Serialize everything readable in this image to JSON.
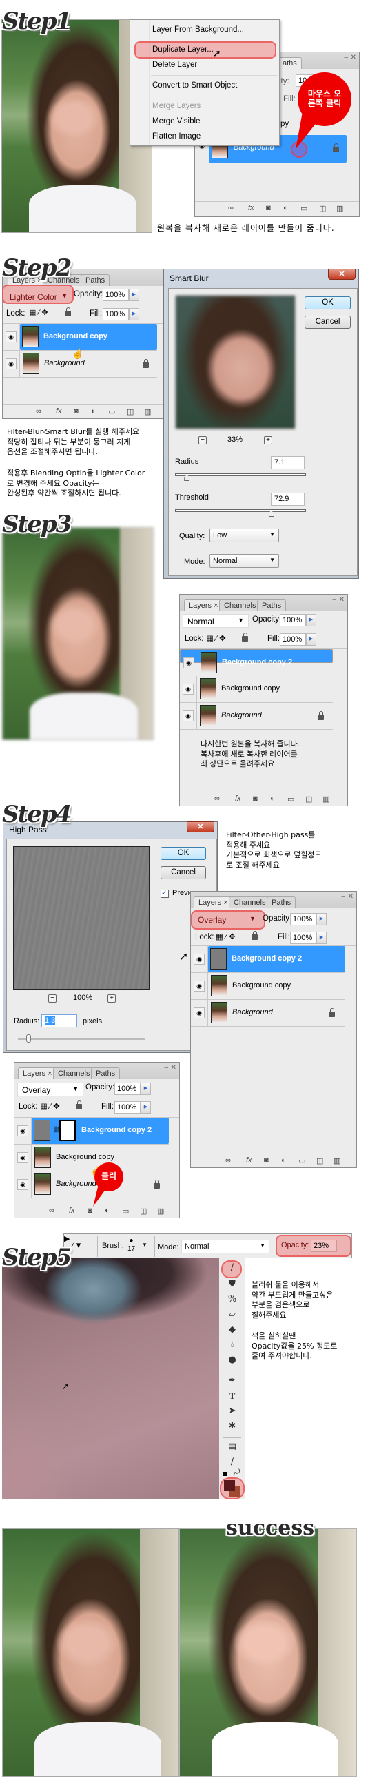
{
  "step1": {
    "logo": "Step1",
    "menu": {
      "items": [
        {
          "label": "Layer From Background...",
          "enabled": true
        },
        {
          "label": "Duplicate Layer...",
          "enabled": true,
          "highlighted": true
        },
        {
          "label": "Delete Layer",
          "enabled": true
        },
        {
          "label": "Convert to Smart Object",
          "enabled": true
        },
        {
          "label": "Merge Layers",
          "enabled": false
        },
        {
          "label": "Merge Visible",
          "enabled": true
        },
        {
          "label": "Flatten Image",
          "enabled": true
        }
      ]
    },
    "panel": {
      "tab_partial": "aths",
      "opacity_partial": "ity:",
      "opacity_partial_value": "10",
      "fill_label": "Fill:",
      "hidden_layer_partial": "py",
      "layer": "Background"
    },
    "bubble": "마우스 오른쪽 클릭",
    "caption": "원복을 복사해 새로운 레이어를 만들어 줍니다."
  },
  "common": {
    "tabs": [
      "Layers ×",
      "Channels",
      "Paths"
    ],
    "opacity_label": "Opacity:",
    "fill_label": "Fill:",
    "lock_label": "Lock:",
    "opacity": "100%",
    "fill": "100%",
    "ok": "OK",
    "cancel": "Cancel"
  },
  "step2": {
    "logo": "Step2",
    "panel": {
      "blend_mode": "Lighter Color",
      "layers": [
        "Background copy",
        "Background"
      ]
    },
    "text1": [
      "Filter-Blur-Smart Blur를 실행 해주세요",
      "적당히 잡티나 튀는 부분이 뭉그러 지게",
      "옵션을 조절해주시면 됩니다."
    ],
    "text2": [
      "적용후 Blending Optin을 Lighter Color",
      "로 변경해 주세요 Opacity는",
      "완성된후 약간씩 조절하시면 됩니다."
    ],
    "dialog": {
      "title": "Smart Blur",
      "zoom": "33%",
      "radius_label": "Radius",
      "radius": "7.1",
      "radius_fraction": 0.071,
      "threshold_label": "Threshold",
      "threshold": "72.9",
      "threshold_fraction": 0.729,
      "quality_label": "Quality:",
      "quality": "Low",
      "mode_label": "Mode:",
      "mode": "Normal"
    }
  },
  "step3": {
    "logo": "Step3",
    "panel": {
      "blend_mode": "Normal",
      "layers": [
        "Background copy 2",
        "Background copy",
        "Background"
      ]
    },
    "text": [
      "다시한번 원본을 복사해 줍니다.",
      "복사후에 새로 복사한 레이어를",
      "최 상단으로 올려주세요"
    ]
  },
  "step4": {
    "logo": "Step4",
    "dialog": {
      "title": "High Pass",
      "preview_label": "Preview",
      "preview_checked": true,
      "zoom": "100%",
      "radius_label": "Radius:",
      "radius": "1.3",
      "unit": "pixels"
    },
    "text": [
      "Filter-Other-High pass를",
      "적용해 주세요",
      "기본적으로 회색으로 덮힐정도",
      "로 조절 해주세요"
    ],
    "panel1": {
      "blend_mode": "Overlay",
      "layers": [
        "Background copy 2",
        "Background copy",
        "Background"
      ]
    },
    "panel2": {
      "blend_mode": "Overlay",
      "layers": [
        "Background copy 2",
        "Background copy",
        "Background"
      ]
    },
    "bubble": "클릭"
  },
  "step5": {
    "logo": "Step5",
    "options": {
      "brush_label": "Brush:",
      "brush_size": "17",
      "mode_label": "Mode:",
      "mode": "Normal",
      "opacity_label": "Opacity:",
      "opacity": "23%"
    },
    "text1": [
      "블러쉬 툴을 이용해서",
      "약간 부드럽게 만들고싶은",
      "부분을 검은색으로",
      "칠해주세요"
    ],
    "text2": [
      "색을 칠하실땐",
      "Opacity값을 25% 정도로",
      "줄여 주셔야합니다."
    ],
    "colors": {
      "foreground": "#5a1a1c",
      "background": "#a04a32"
    }
  },
  "success": {
    "label": "success"
  }
}
